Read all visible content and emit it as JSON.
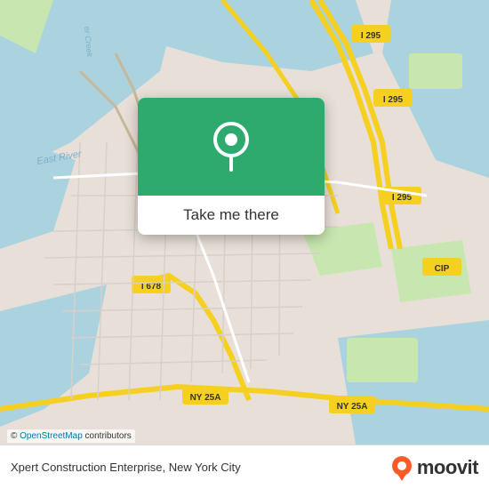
{
  "map": {
    "background_color": "#e8e0d8",
    "attribution": "© OpenStreetMap contributors",
    "openstreetmap_text": "OpenStreetMap"
  },
  "card": {
    "button_label": "Take me there",
    "pin_icon": "location-pin"
  },
  "bottom_bar": {
    "place_name": "Xpert Construction Enterprise, New York City",
    "moovit_label": "moovit",
    "attribution_prefix": "© ",
    "attribution_link_text": "OpenStreetMap",
    "attribution_suffix": " contributors"
  }
}
